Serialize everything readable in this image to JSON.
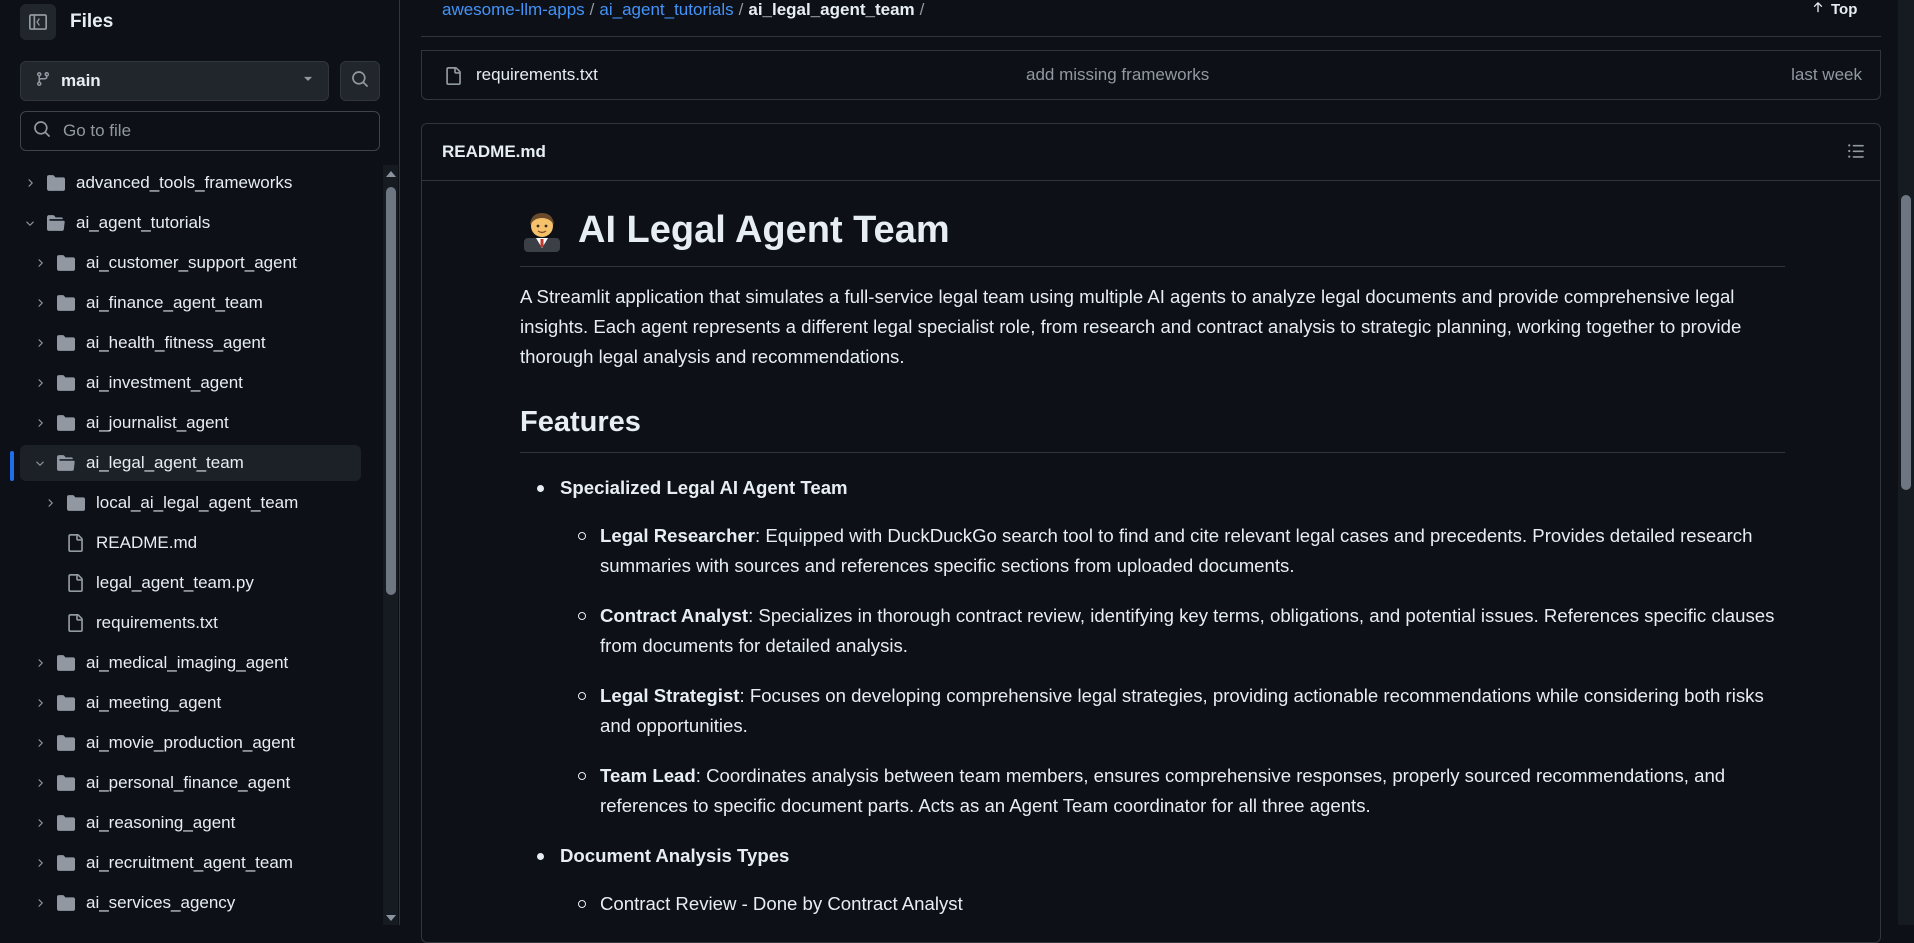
{
  "sidebar": {
    "title": "Files",
    "branch": "main",
    "goto_placeholder": "Go to file",
    "tree": [
      {
        "label": "advanced_tools_frameworks",
        "type": "folder",
        "depth": 0,
        "expanded": false
      },
      {
        "label": "ai_agent_tutorials",
        "type": "folder",
        "depth": 0,
        "expanded": true
      },
      {
        "label": "ai_customer_support_agent",
        "type": "folder",
        "depth": 1,
        "expanded": false
      },
      {
        "label": "ai_finance_agent_team",
        "type": "folder",
        "depth": 1,
        "expanded": false
      },
      {
        "label": "ai_health_fitness_agent",
        "type": "folder",
        "depth": 1,
        "expanded": false
      },
      {
        "label": "ai_investment_agent",
        "type": "folder",
        "depth": 1,
        "expanded": false
      },
      {
        "label": "ai_journalist_agent",
        "type": "folder",
        "depth": 1,
        "expanded": false
      },
      {
        "label": "ai_legal_agent_team",
        "type": "folder",
        "depth": 1,
        "expanded": true,
        "selected": true
      },
      {
        "label": "local_ai_legal_agent_team",
        "type": "folder",
        "depth": 2,
        "expanded": false
      },
      {
        "label": "README.md",
        "type": "file",
        "depth": 2
      },
      {
        "label": "legal_agent_team.py",
        "type": "file",
        "depth": 2
      },
      {
        "label": "requirements.txt",
        "type": "file",
        "depth": 2
      },
      {
        "label": "ai_medical_imaging_agent",
        "type": "folder",
        "depth": 1,
        "expanded": false
      },
      {
        "label": "ai_meeting_agent",
        "type": "folder",
        "depth": 1,
        "expanded": false
      },
      {
        "label": "ai_movie_production_agent",
        "type": "folder",
        "depth": 1,
        "expanded": false
      },
      {
        "label": "ai_personal_finance_agent",
        "type": "folder",
        "depth": 1,
        "expanded": false
      },
      {
        "label": "ai_reasoning_agent",
        "type": "folder",
        "depth": 1,
        "expanded": false
      },
      {
        "label": "ai_recruitment_agent_team",
        "type": "folder",
        "depth": 1,
        "expanded": false
      },
      {
        "label": "ai_services_agency",
        "type": "folder",
        "depth": 1,
        "expanded": false
      }
    ]
  },
  "breadcrumb": {
    "items": [
      "awesome-llm-apps",
      "ai_agent_tutorials"
    ],
    "current": "ai_legal_agent_team",
    "trailing": "/",
    "separator": "/"
  },
  "top_button": "Top",
  "file_row": {
    "name": "requirements.txt",
    "commit": "add missing frameworks",
    "when": "last week"
  },
  "readme": {
    "filename": "README.md",
    "title": "AI Legal Agent Team",
    "intro": "A Streamlit application that simulates a full-service legal team using multiple AI agents to analyze legal documents and provide comprehensive legal insights. Each agent represents a different legal specialist role, from research and contract analysis to strategic planning, working together to provide thorough legal analysis and recommendations.",
    "features_heading": "Features",
    "features": [
      {
        "title": "Specialized Legal AI Agent Team",
        "items": [
          {
            "term": "Legal Researcher",
            "desc": ": Equipped with DuckDuckGo search tool to find and cite relevant legal cases and precedents. Provides detailed research summaries with sources and references specific sections from uploaded documents."
          },
          {
            "term": "Contract Analyst",
            "desc": ": Specializes in thorough contract review, identifying key terms, obligations, and potential issues. References specific clauses from documents for detailed analysis."
          },
          {
            "term": "Legal Strategist",
            "desc": ": Focuses on developing comprehensive legal strategies, providing actionable recommendations while considering both risks and opportunities."
          },
          {
            "term": "Team Lead",
            "desc": ": Coordinates analysis between team members, ensures comprehensive responses, properly sourced recommendations, and references to specific document parts. Acts as an Agent Team coordinator for all three agents."
          }
        ]
      },
      {
        "title": "Document Analysis Types",
        "items": [
          {
            "term": "",
            "desc": "Contract Review - Done by Contract Analyst"
          }
        ]
      }
    ]
  },
  "colors": {
    "background": "#0d1117",
    "border": "#30363d",
    "link": "#4493f8",
    "muted": "#9198a1",
    "text": "#e6edf3",
    "selection_accent": "#1f6feb"
  },
  "icons": {
    "sidebar_toggle": "sidebar-collapse-icon",
    "branch": "git-branch-icon",
    "dropdown": "triangle-down-icon",
    "search": "search-icon",
    "folder": "folder-icon",
    "folder_open": "folder-open-icon",
    "file": "file-icon",
    "top_arrow": "arrow-up-icon",
    "outline": "list-unordered-icon"
  }
}
